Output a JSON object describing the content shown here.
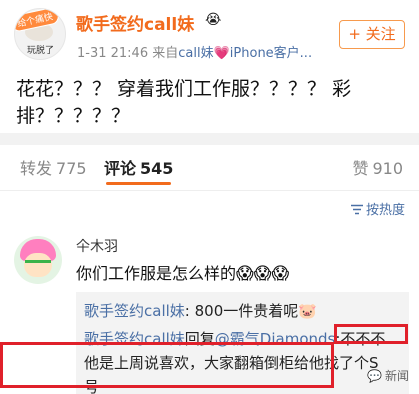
{
  "post": {
    "author_name": "歌手签约call妹",
    "author_emoji": "😭",
    "avatar_sticker_text": "给个痛快",
    "avatar_caption": "玩脱了",
    "timestamp": "1-31 21:46",
    "source_prefix": "来自",
    "source_user": "call妹",
    "source_heart": "💗",
    "source_device": "iPhone客户...",
    "follow_label": "+ 关注",
    "body": "花花？？？ 穿着我们工作服？？？？ 彩排？？？？？"
  },
  "tabs": {
    "repost": {
      "label": "转发",
      "count": "775"
    },
    "comment": {
      "label": "评论",
      "count": "545"
    },
    "like": {
      "label": "赞",
      "count": "910"
    }
  },
  "sort": {
    "label": "按热度",
    "icon": "sort-filter-icon"
  },
  "comment": {
    "author": "仐木羽",
    "text": "你们工作服是怎么样的",
    "emojis": "😱😱😱",
    "replies": [
      {
        "name": "歌手签约call妹",
        "text": ": 800一件贵着呢🐷"
      },
      {
        "name": "歌手签约call妹",
        "text_prefix": "回复",
        "mention": "@霸气Diamonds",
        "text": ":不不不"
      },
      {
        "text": "他是上周说喜欢，大家翻箱倒柜给他找了个S"
      },
      {
        "text": "号"
      }
    ]
  },
  "watermark": "新闻",
  "colors": {
    "brand_orange": "#f26b1d",
    "link_blue": "#4a6fa5",
    "highlight_red": "#e0202a"
  }
}
